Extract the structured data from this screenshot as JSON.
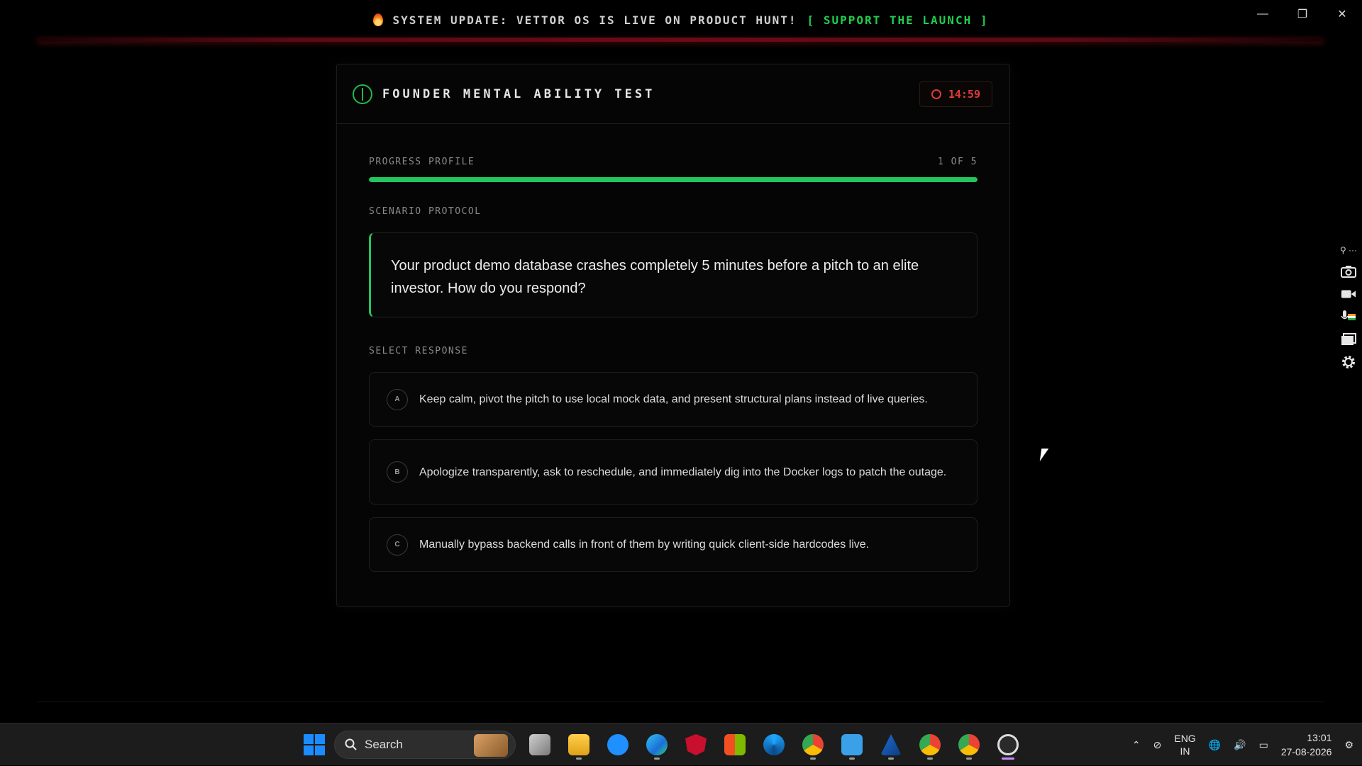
{
  "banner": {
    "text": "SYSTEM UPDATE: VETTOR OS IS LIVE ON PRODUCT HUNT!",
    "link": "[ SUPPORT THE LAUNCH ]",
    "icon": "flame-icon"
  },
  "window": {
    "minimize": "—",
    "restore": "❐",
    "close": "✕"
  },
  "test": {
    "title": "FOUNDER MENTAL ABILITY TEST",
    "timer": "14:59",
    "progress_label": "PROGRESS PROFILE",
    "progress_count": "1 OF 5",
    "progress_fraction": 1.0,
    "scenario_label": "SCENARIO PROTOCOL",
    "scenario_text": "Your product demo database crashes completely 5 minutes before a pitch to an elite investor. How do you respond?",
    "select_label": "SELECT RESPONSE",
    "options": [
      {
        "letter": "A",
        "text": "Keep calm, pivot the pitch to use local mock data, and present structural plans instead of live queries."
      },
      {
        "letter": "B",
        "text": "Apologize transparently, ask to reschedule, and immediately dig into the Docker logs to patch the outage."
      },
      {
        "letter": "C",
        "text": "Manually bypass backend calls in front of them by writing quick client-side hardcodes live."
      }
    ]
  },
  "taskbar": {
    "search_placeholder": "Search",
    "lang_top": "ENG",
    "lang_bottom": "IN",
    "time": "13:01",
    "date": "27-08-2026"
  },
  "colors": {
    "accent_green": "#22c55e",
    "timer_red": "#e03a3a",
    "banner_rule": "#5a0a14"
  }
}
